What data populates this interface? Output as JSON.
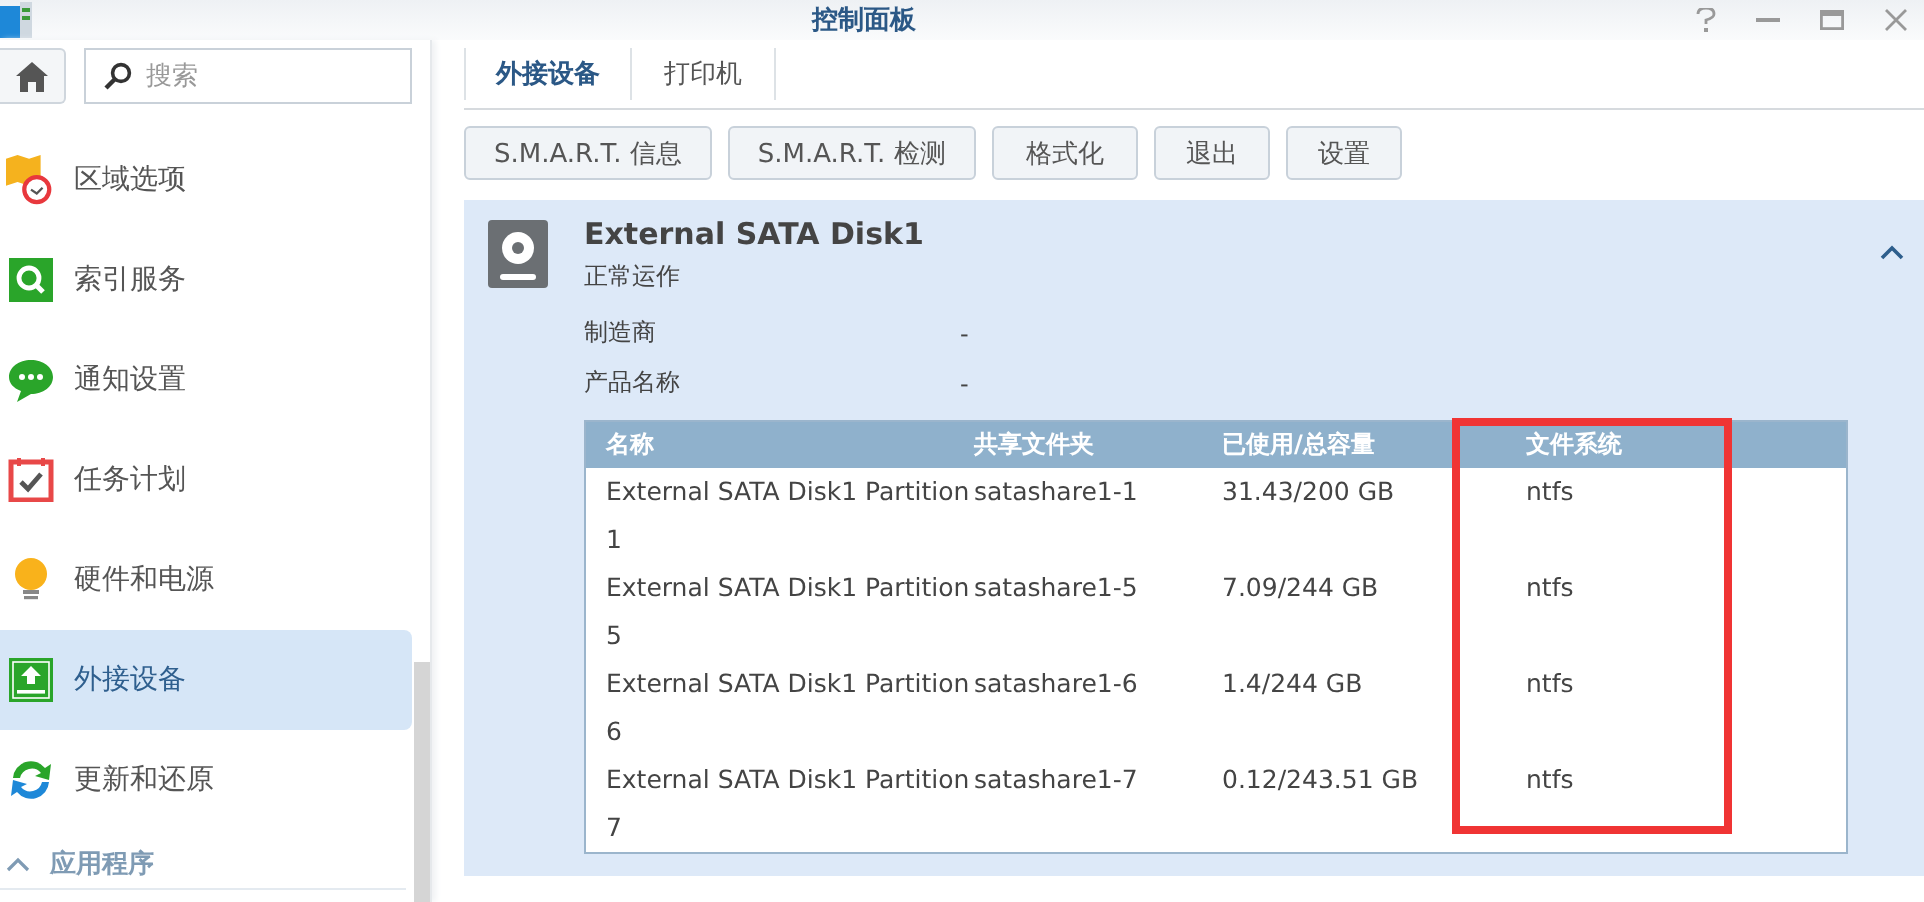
{
  "window": {
    "title": "控制面板"
  },
  "search": {
    "placeholder": "搜索"
  },
  "sidebar": {
    "items": [
      {
        "label": "区域选项",
        "kind": "region",
        "selected": false
      },
      {
        "label": "索引服务",
        "kind": "index",
        "selected": false
      },
      {
        "label": "通知设置",
        "kind": "notify",
        "selected": false
      },
      {
        "label": "任务计划",
        "kind": "task",
        "selected": false
      },
      {
        "label": "硬件和电源",
        "kind": "power",
        "selected": false
      },
      {
        "label": "外接设备",
        "kind": "external",
        "selected": true
      },
      {
        "label": "更新和还原",
        "kind": "update",
        "selected": false
      }
    ],
    "section": {
      "label": "应用程序",
      "expanded": true
    }
  },
  "tabs": [
    {
      "label": "外接设备",
      "selected": true
    },
    {
      "label": "打印机",
      "selected": false
    }
  ],
  "buttons": [
    "S.M.A.R.T. 信息",
    "S.M.A.R.T. 检测",
    "格式化",
    "退出",
    "设置"
  ],
  "disk": {
    "name": "External SATA Disk1",
    "status": "正常运作",
    "expanded": true,
    "properties": [
      {
        "label": "制造商",
        "value": "-"
      },
      {
        "label": "产品名称",
        "value": "-"
      }
    ],
    "table": {
      "columns": [
        "名称",
        "共享文件夹",
        "已使用/总容量",
        "文件系统"
      ],
      "rows": [
        [
          "External SATA Disk1 Partition 1",
          "satashare1-1",
          "31.43/200 GB",
          "ntfs"
        ],
        [
          "External SATA Disk1 Partition 5",
          "satashare1-5",
          "7.09/244 GB",
          "ntfs"
        ],
        [
          "External SATA Disk1 Partition 6",
          "satashare1-6",
          "1.4/244 GB",
          "ntfs"
        ],
        [
          "External SATA Disk1 Partition 7",
          "satashare1-7",
          "0.12/243.51 GB",
          "ntfs"
        ]
      ]
    }
  }
}
